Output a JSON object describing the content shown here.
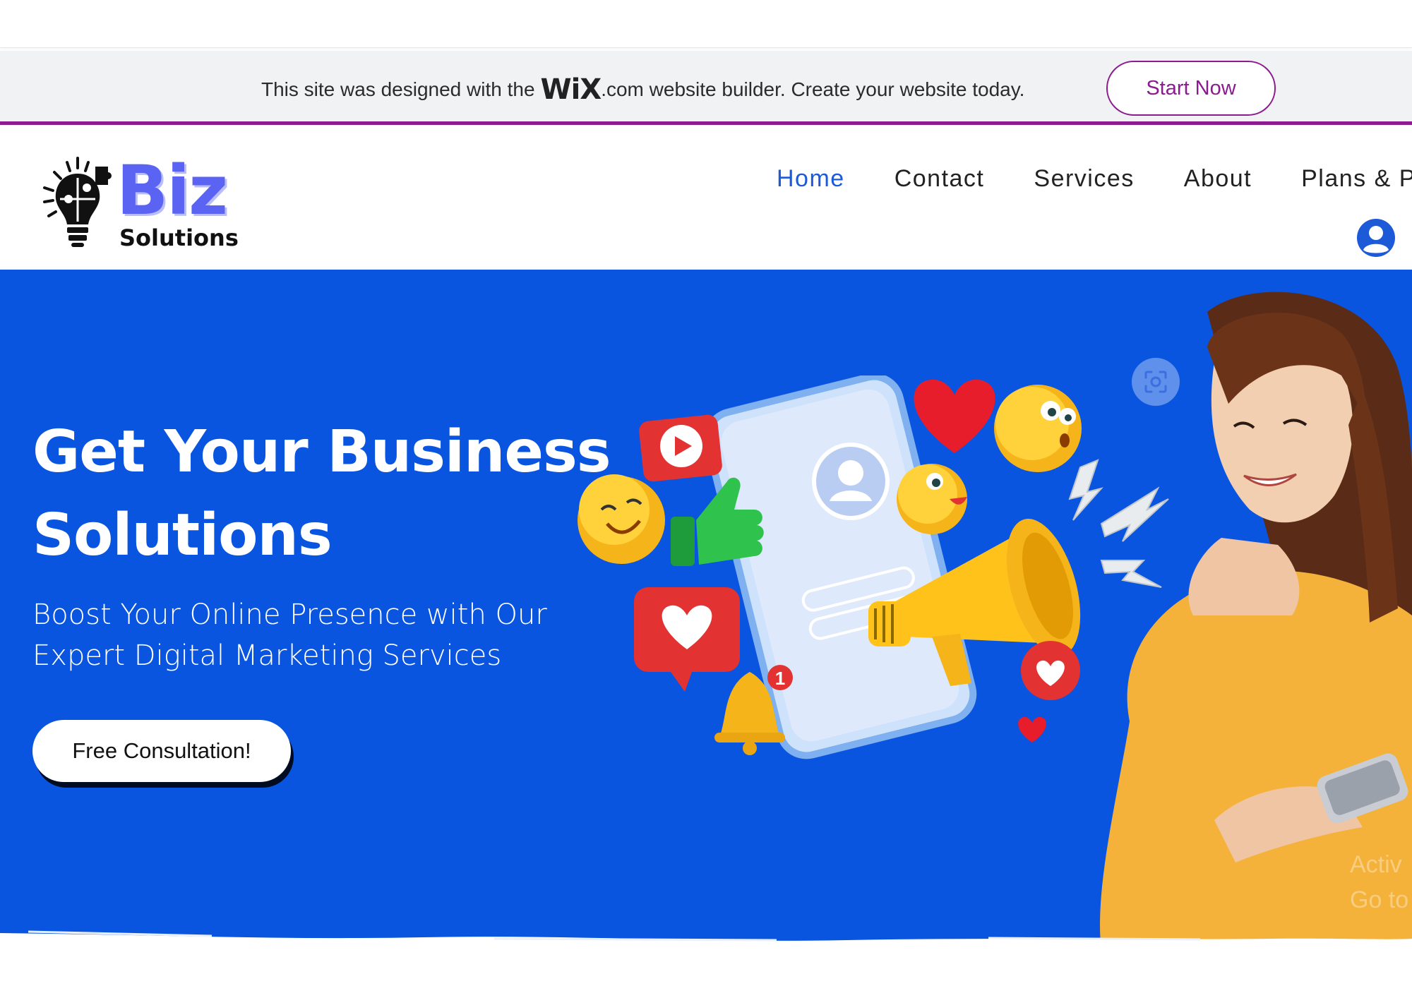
{
  "banner": {
    "text_before": "This site was designed with the",
    "wix_logo": "WiX",
    "text_after": ".com website builder. Create your website today.",
    "cta_label": "Start Now"
  },
  "header": {
    "logo_main": "Biz",
    "logo_sub": "Solutions",
    "nav": [
      {
        "label": "Home",
        "active": true
      },
      {
        "label": "Contact"
      },
      {
        "label": "Services"
      },
      {
        "label": "About"
      },
      {
        "label": "Plans & P"
      }
    ],
    "icons": {
      "user": "user-account-icon",
      "logo": "lightbulb-puzzle-icon"
    }
  },
  "hero": {
    "title": "Get Your Business Solutions",
    "subtitle": "Boost Your Online Presence with Our Expert Digital Marketing Services",
    "cta_label": "Free Consultation!",
    "notification_count": "1",
    "ghost_text": "Activ\nGo to"
  },
  "colors": {
    "hero_blue": "#0a55e0",
    "nav_active": "#1d5ad8",
    "wix_accent": "#8b1b8f",
    "logo_purple": "#5a63f2"
  }
}
